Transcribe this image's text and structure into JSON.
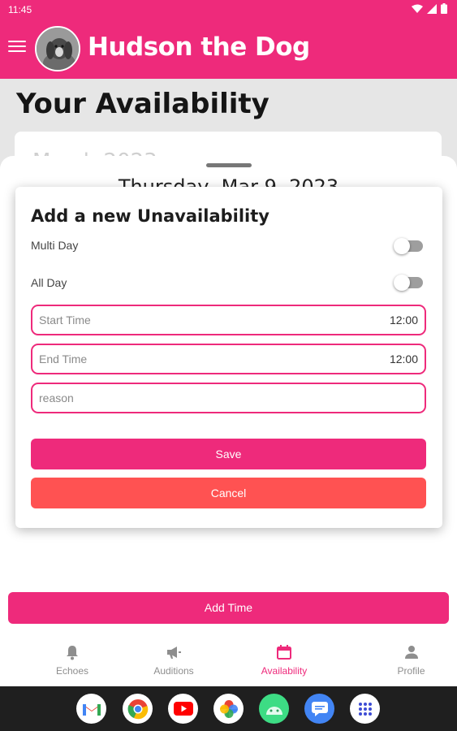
{
  "status_bar": {
    "time": "11:45"
  },
  "app_bar": {
    "title": "Hudson the Dog"
  },
  "page": {
    "title": "Your Availability",
    "month_partial": "March 2023"
  },
  "sheet": {
    "date_partial": "Thursday, Mar 9, 2023"
  },
  "dialog": {
    "title": "Add a new Unavailability",
    "multi_day_label": "Multi Day",
    "all_day_label": "All Day",
    "multi_day_on": false,
    "all_day_on": false,
    "start_time": {
      "placeholder": "Start Time",
      "value": "12:00"
    },
    "end_time": {
      "placeholder": "End Time",
      "value": "12:00"
    },
    "reason": {
      "placeholder": "reason"
    },
    "save_label": "Save",
    "cancel_label": "Cancel"
  },
  "add_time_label": "Add Time",
  "bottom_nav": [
    {
      "label": "Echoes",
      "icon": "bell-icon",
      "active": false
    },
    {
      "label": "Auditions",
      "icon": "megaphone-icon",
      "active": false
    },
    {
      "label": "Availability",
      "icon": "calendar-icon",
      "active": true
    },
    {
      "label": "Profile",
      "icon": "person-icon",
      "active": false
    }
  ],
  "dock": [
    "gmail-icon",
    "chrome-icon",
    "youtube-icon",
    "photos-icon",
    "android-icon",
    "messages-icon",
    "app-drawer-icon"
  ],
  "colors": {
    "primary": "#ee2a7b",
    "cancel": "#ff5252",
    "inactive": "#8e8e8e"
  }
}
